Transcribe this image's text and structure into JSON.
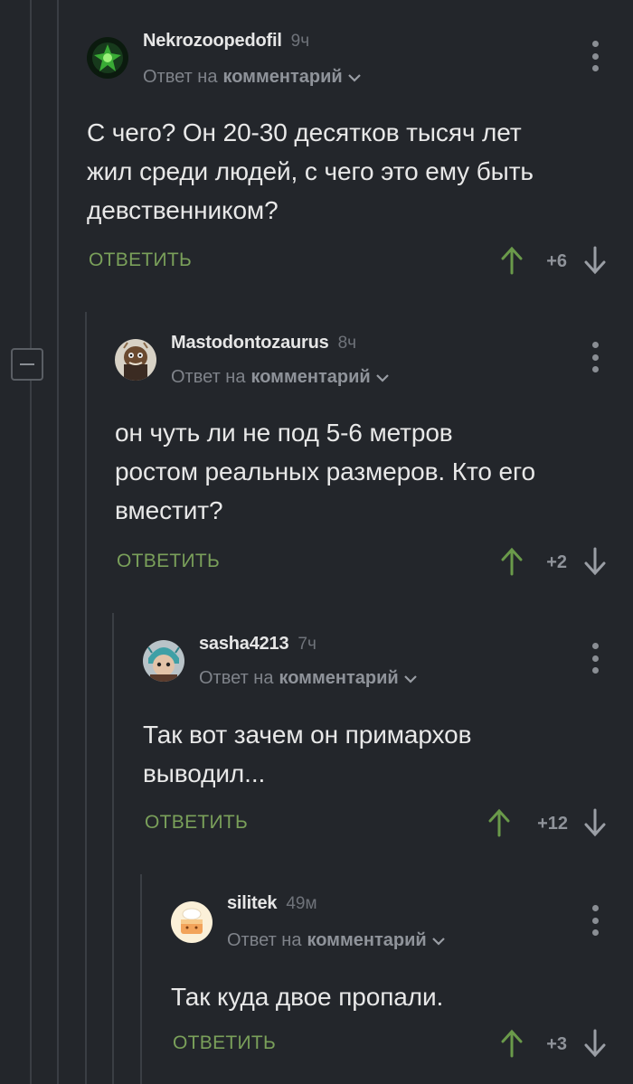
{
  "comments": [
    {
      "author": "Nekrozoopedofil",
      "time": "9ч",
      "reply_prefix": "Ответ на",
      "reply_target": "комментарий",
      "text": "С чего? Он 20-30 десятков тысяч лет\nжил среди людей, с чего это ему быть\nдевственником?",
      "reply_label": "ОТВЕТИТЬ",
      "score": "+6",
      "avatar": "green-emblem-avatar"
    },
    {
      "author": "Mastodontozaurus",
      "time": "8ч",
      "reply_prefix": "Ответ на",
      "reply_target": "комментарий",
      "text": "он чуть ли не под 5-6 метров\nростом реальных размеров. Кто его\nвместит?",
      "reply_label": "ОТВЕТИТЬ",
      "score": "+2",
      "avatar": "creature-avatar"
    },
    {
      "author": "sasha4213",
      "time": "7ч",
      "reply_prefix": "Ответ на",
      "reply_target": "комментарий",
      "text": "Так вот зачем он примархов\nвыводил...",
      "reply_label": "ОТВЕТИТЬ",
      "score": "+12",
      "avatar": "character-avatar"
    },
    {
      "author": "silitek",
      "time": "49м",
      "reply_prefix": "Ответ на",
      "reply_target": "комментарий",
      "text": "Так куда двое пропали.",
      "reply_label": "ОТВЕТИТЬ",
      "score": "+3",
      "avatar": "cake-avatar"
    }
  ],
  "colors": {
    "background": "#23262b",
    "reply_green": "#7aa05a",
    "upvote_green": "#6a9a4a",
    "thread_line": "#3a3e44"
  }
}
